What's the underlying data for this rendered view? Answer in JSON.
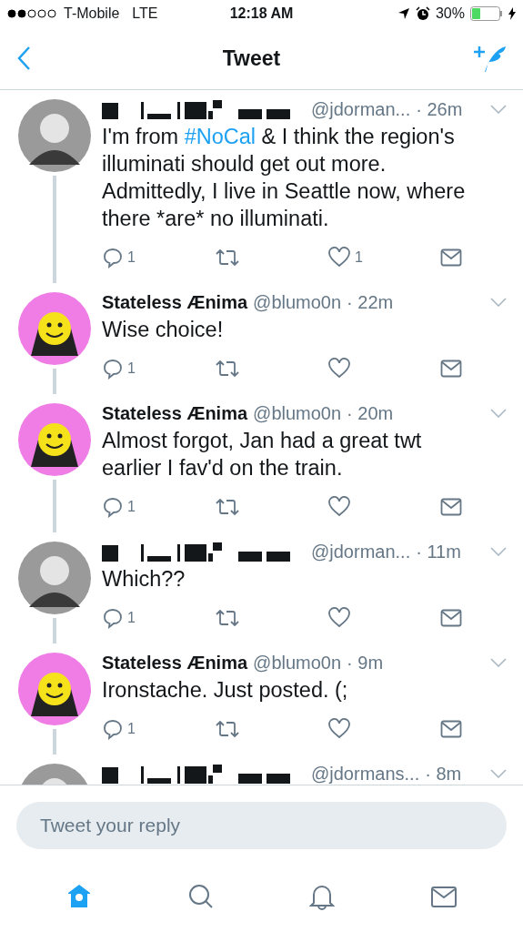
{
  "status_bar": {
    "carrier": "T-Mobile",
    "network": "LTE",
    "time": "12:18 AM",
    "battery": "30%"
  },
  "nav": {
    "title": "Tweet"
  },
  "tweets": [
    {
      "author": {
        "kind": "redacted",
        "handle": "@jdorman...",
        "time": "· 26m"
      },
      "avatar": {
        "kind": "photo"
      },
      "body": [
        {
          "text": "I'm from "
        },
        {
          "text": "#NoCal",
          "kind": "hashtag"
        },
        {
          "text": " & I think the region's illuminati should get out more. Admittedly, I live in Seattle now, where there *are* no illuminati."
        }
      ],
      "replies": "1",
      "likes": "1"
    },
    {
      "author": {
        "kind": "named",
        "name": "Stateless Ænima",
        "handle": "@blumo0n",
        "time": "· 22m"
      },
      "avatar": {
        "kind": "smiley"
      },
      "body": [
        {
          "text": "Wise choice!"
        }
      ],
      "replies": "1"
    },
    {
      "author": {
        "kind": "named",
        "name": "Stateless Ænima",
        "handle": "@blumo0n",
        "time": "· 20m"
      },
      "avatar": {
        "kind": "smiley"
      },
      "body": [
        {
          "text": "Almost forgot, Jan had a great twt earlier I fav'd on the train."
        }
      ],
      "replies": "1"
    },
    {
      "author": {
        "kind": "redacted",
        "handle": "@jdorman...",
        "time": "· 11m"
      },
      "avatar": {
        "kind": "photo"
      },
      "body": [
        {
          "text": "Which??"
        }
      ],
      "replies": "1"
    },
    {
      "author": {
        "kind": "named",
        "name": "Stateless Ænima",
        "handle": "@blumo0n",
        "time": "· 9m"
      },
      "avatar": {
        "kind": "smiley"
      },
      "body": [
        {
          "text": "Ironstache. Just posted. (;"
        }
      ],
      "replies": "1"
    },
    {
      "author": {
        "kind": "redacted",
        "handle": "@jdormans...",
        "time": "· 8m"
      },
      "avatar": {
        "kind": "photo"
      },
      "cut": true
    }
  ],
  "reply_field": {
    "placeholder": "Tweet your reply"
  },
  "tab_bar": [
    {
      "kind": "home",
      "selected": true
    },
    {
      "kind": "search",
      "selected": false
    },
    {
      "kind": "notifications",
      "selected": false
    },
    {
      "kind": "messages",
      "selected": false
    }
  ]
}
